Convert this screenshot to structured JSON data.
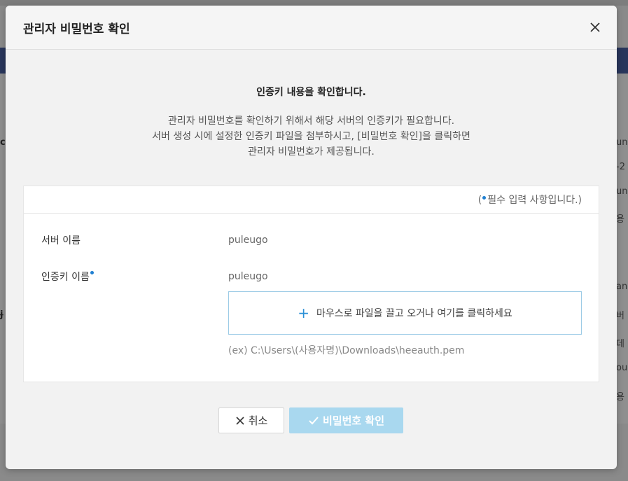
{
  "background": {
    "left_items": [
      "c",
      "ɉ"
    ],
    "right_items": [
      "un",
      "-2",
      "un",
      "용",
      "an",
      "버",
      "데",
      "ou",
      "용"
    ]
  },
  "dialog": {
    "title": "관리자 비밀번호 확인",
    "close_icon": "close-icon",
    "headline": "인증키 내용을 확인합니다.",
    "description": [
      "관리자 비밀번호를 확인하기 위해서 해당 서버의 인증키가 필요합니다.",
      "서버 생성 시에 설정한 인증키 파일을 첨부하시고, [비밀번호 확인]을 클릭하면",
      "관리자 비밀번호가 제공됩니다."
    ],
    "required_note": {
      "open": "(",
      "text": "필수 입력 사항입니다.)"
    },
    "form": {
      "server_name_label": "서버 이름",
      "server_name_value": "puleugo",
      "key_name_label": "인증키 이름",
      "key_name_value": "puleugo",
      "dropzone_text": "마우스로 파일을 끌고 오거나 여기를 클릭하세요",
      "hint": "(ex) C:\\Users\\(사용자명)\\Downloads\\heeauth.pem"
    },
    "buttons": {
      "cancel": "취소",
      "confirm": "비밀번호 확인"
    }
  },
  "colors": {
    "accent": "#1f7fd1",
    "confirm_disabled": "#a9d8ef",
    "navbar": "#29365c"
  }
}
